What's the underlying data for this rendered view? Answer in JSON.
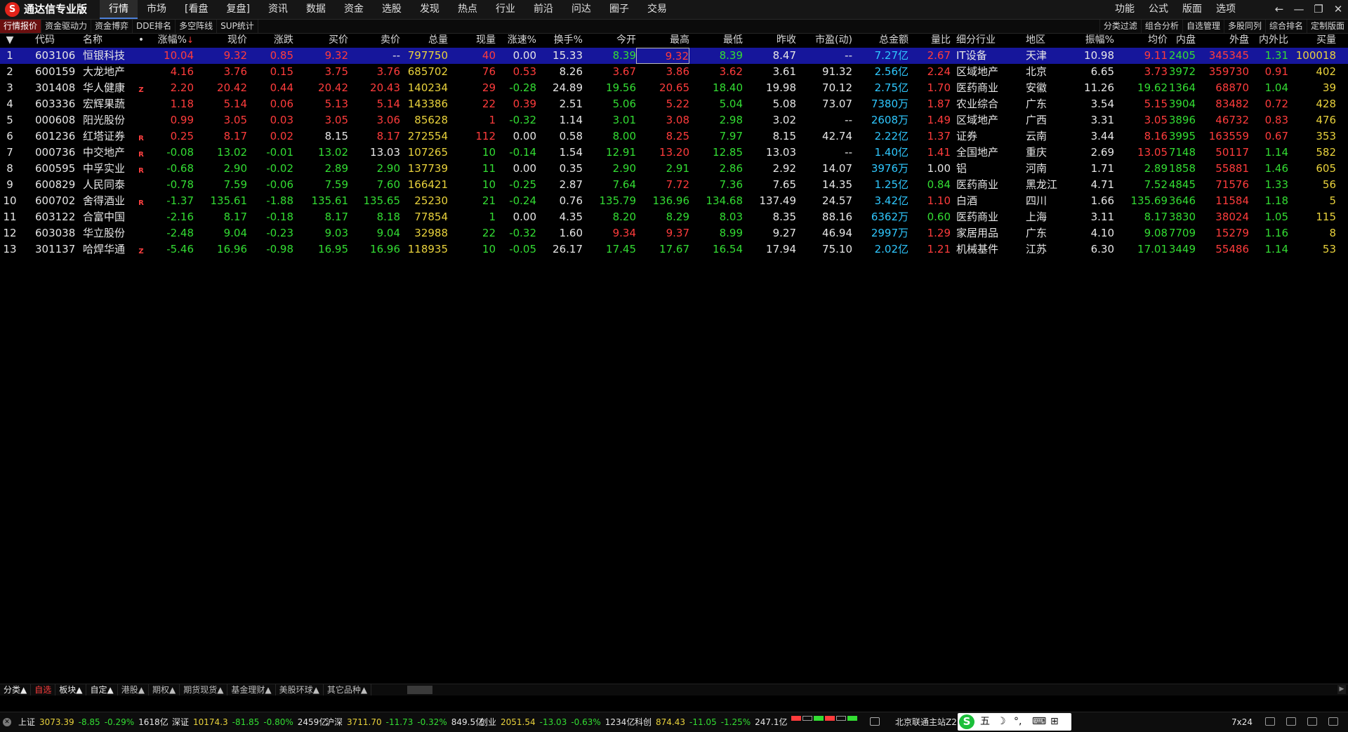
{
  "app": {
    "logo": "S",
    "title": "通达信专业版"
  },
  "menu": {
    "items": [
      "行情",
      "市场",
      "[看盘",
      "复盘]",
      "资讯",
      "数据",
      "资金",
      "选股",
      "发现",
      "热点",
      "行业",
      "前沿",
      "问达",
      "圈子",
      "交易"
    ],
    "active_index": 0,
    "right": [
      "功能",
      "公式",
      "版面",
      "选项"
    ]
  },
  "window_controls": [
    "←",
    "—",
    "❐",
    "✕"
  ],
  "subtabs_left": [
    "行情报价",
    "资金驱动力",
    "资金博弈",
    "DDE排名",
    "多空阵线",
    "SUP统计"
  ],
  "subtabs_right": [
    "分类过滤",
    "组合分析",
    "自选管理",
    "多股同列",
    "综合排名",
    "定制版面"
  ],
  "table": {
    "headers": [
      "",
      "代码",
      "名称",
      "•",
      "涨幅%",
      "现价",
      "涨跌",
      "买价",
      "卖价",
      "总量",
      "现量",
      "涨速%",
      "换手%",
      "今开",
      "最高",
      "最低",
      "昨收",
      "市盈(动)",
      "总金额",
      "量比",
      "细分行业",
      "地区",
      "振幅%",
      "均价",
      "内盘",
      "外盘",
      "内外比",
      "买量"
    ],
    "header_marker": "▼",
    "sort_arrow": "↓",
    "rows": [
      [
        "1",
        "603106",
        "恒银科技",
        "",
        "10.04",
        "9.32",
        "0.85",
        "9.32",
        "--",
        "797750",
        "40",
        "0.00",
        "15.33",
        "8.39",
        "9.32",
        "8.39",
        "8.47",
        "--",
        "7.27亿",
        "2.67",
        "IT设备",
        "天津",
        "10.98",
        "9.11",
        "2405",
        "345345",
        "1.31",
        "100018"
      ],
      [
        "2",
        "600159",
        "大龙地产",
        "",
        "4.16",
        "3.76",
        "0.15",
        "3.75",
        "3.76",
        "685702",
        "76",
        "0.53",
        "8.26",
        "3.67",
        "3.86",
        "3.62",
        "3.61",
        "91.32",
        "2.56亿",
        "2.24",
        "区域地产",
        "北京",
        "6.65",
        "3.73",
        "3972",
        "359730",
        "0.91",
        "402"
      ],
      [
        "3",
        "301408",
        "华人健康",
        "Z",
        "2.20",
        "20.42",
        "0.44",
        "20.42",
        "20.43",
        "140234",
        "29",
        "-0.28",
        "24.89",
        "19.56",
        "20.65",
        "18.40",
        "19.98",
        "70.12",
        "2.75亿",
        "1.70",
        "医药商业",
        "安徽",
        "11.26",
        "19.62",
        "1364",
        "68870",
        "1.04",
        "39"
      ],
      [
        "4",
        "603336",
        "宏辉果蔬",
        "",
        "1.18",
        "5.14",
        "0.06",
        "5.13",
        "5.14",
        "143386",
        "22",
        "0.39",
        "2.51",
        "5.06",
        "5.22",
        "5.04",
        "5.08",
        "73.07",
        "7380万",
        "1.87",
        "农业综合",
        "广东",
        "3.54",
        "5.15",
        "3904",
        "83482",
        "0.72",
        "428"
      ],
      [
        "5",
        "000608",
        "阳光股份",
        "",
        "0.99",
        "3.05",
        "0.03",
        "3.05",
        "3.06",
        "85628",
        "1",
        "-0.32",
        "1.14",
        "3.01",
        "3.08",
        "2.98",
        "3.02",
        "--",
        "2608万",
        "1.49",
        "区域地产",
        "广西",
        "3.31",
        "3.05",
        "3896",
        "46732",
        "0.83",
        "476"
      ],
      [
        "6",
        "601236",
        "红塔证券",
        "R",
        "0.25",
        "8.17",
        "0.02",
        "8.15",
        "8.17",
        "272554",
        "112",
        "0.00",
        "0.58",
        "8.00",
        "8.25",
        "7.97",
        "8.15",
        "42.74",
        "2.22亿",
        "1.37",
        "证券",
        "云南",
        "3.44",
        "8.16",
        "3995",
        "163559",
        "0.67",
        "353"
      ],
      [
        "7",
        "000736",
        "中交地产",
        "R",
        "-0.08",
        "13.02",
        "-0.01",
        "13.02",
        "13.03",
        "107265",
        "10",
        "-0.14",
        "1.54",
        "12.91",
        "13.20",
        "12.85",
        "13.03",
        "--",
        "1.40亿",
        "1.41",
        "全国地产",
        "重庆",
        "2.69",
        "13.05",
        "7148",
        "50117",
        "1.14",
        "582"
      ],
      [
        "8",
        "600595",
        "中孚实业",
        "R",
        "-0.68",
        "2.90",
        "-0.02",
        "2.89",
        "2.90",
        "137739",
        "11",
        "0.00",
        "0.35",
        "2.90",
        "2.91",
        "2.86",
        "2.92",
        "14.07",
        "3976万",
        "1.00",
        "铝",
        "河南",
        "1.71",
        "2.89",
        "1858",
        "55881",
        "1.46",
        "605"
      ],
      [
        "9",
        "600829",
        "人民同泰",
        "",
        "-0.78",
        "7.59",
        "-0.06",
        "7.59",
        "7.60",
        "166421",
        "10",
        "-0.25",
        "2.87",
        "7.64",
        "7.72",
        "7.36",
        "7.65",
        "14.35",
        "1.25亿",
        "0.84",
        "医药商业",
        "黑龙江",
        "4.71",
        "7.52",
        "4845",
        "71576",
        "1.33",
        "56"
      ],
      [
        "10",
        "600702",
        "舍得酒业",
        "R",
        "-1.37",
        "135.61",
        "-1.88",
        "135.61",
        "135.65",
        "25230",
        "21",
        "-0.24",
        "0.76",
        "135.79",
        "136.96",
        "134.68",
        "137.49",
        "24.57",
        "3.42亿",
        "1.10",
        "白酒",
        "四川",
        "1.66",
        "135.69",
        "3646",
        "11584",
        "1.18",
        "5"
      ],
      [
        "11",
        "603122",
        "合富中国",
        "",
        "-2.16",
        "8.17",
        "-0.18",
        "8.17",
        "8.18",
        "77854",
        "1",
        "0.00",
        "4.35",
        "8.20",
        "8.29",
        "8.03",
        "8.35",
        "88.16",
        "6362万",
        "0.60",
        "医药商业",
        "上海",
        "3.11",
        "8.17",
        "3830",
        "38024",
        "1.05",
        "115"
      ],
      [
        "12",
        "603038",
        "华立股份",
        "",
        "-2.48",
        "9.04",
        "-0.23",
        "9.03",
        "9.04",
        "32988",
        "22",
        "-0.32",
        "1.60",
        "9.34",
        "9.37",
        "8.99",
        "9.27",
        "46.94",
        "2997万",
        "1.29",
        "家居用品",
        "广东",
        "4.10",
        "9.08",
        "7709",
        "15279",
        "1.16",
        "8"
      ],
      [
        "13",
        "301137",
        "哈焊华通",
        "Z",
        "-5.46",
        "16.96",
        "-0.98",
        "16.95",
        "16.96",
        "118935",
        "10",
        "-0.05",
        "26.17",
        "17.45",
        "17.67",
        "16.54",
        "17.94",
        "75.10",
        "2.02亿",
        "1.21",
        "机械基件",
        "江苏",
        "6.30",
        "17.01",
        "3449",
        "55486",
        "1.14",
        "53"
      ]
    ],
    "selected_row": 0
  },
  "bottom_tabs": [
    "分类▲",
    "自选",
    "板块▲",
    "自定▲",
    "港股▲",
    "期权▲",
    "期货现货▲",
    "基金理财▲",
    "美股环球▲",
    "其它品种▲"
  ],
  "bottom_tabs_selected": 1,
  "status": {
    "close_icon": "✕",
    "indices": [
      {
        "name": "上证",
        "value": "3073.39",
        "change": "-8.85",
        "pct": "-0.29%",
        "amount": "1618亿"
      },
      {
        "name": "深证",
        "value": "10174.3",
        "change": "-81.85",
        "pct": "-0.80%",
        "amount": "2459亿"
      },
      {
        "name": "沪深",
        "value": "3711.70",
        "change": "-11.73",
        "pct": "-0.32%",
        "amount": "849.5亿"
      },
      {
        "name": "创业",
        "value": "2051.54",
        "change": "-13.03",
        "pct": "-0.63%",
        "amount": "1234亿"
      },
      {
        "name": "科创",
        "value": "874.43",
        "change": "-11.05",
        "pct": "-1.25%",
        "amount": "247.1亿"
      }
    ],
    "server": "北京联通主站Z2",
    "ime": {
      "logo": "S",
      "mode": "五",
      "moon": "☽",
      "punct": "°,",
      "keyboard": "⌨",
      "grid": "⊞"
    },
    "service": "7x24"
  },
  "colors": {
    "up": "#ff3c3c",
    "down": "#33dd33",
    "volume": "#e9d23c",
    "amount": "#2fc8ff",
    "selected_bg": "#16169b",
    "active_subtab": "#6b0f0f"
  }
}
